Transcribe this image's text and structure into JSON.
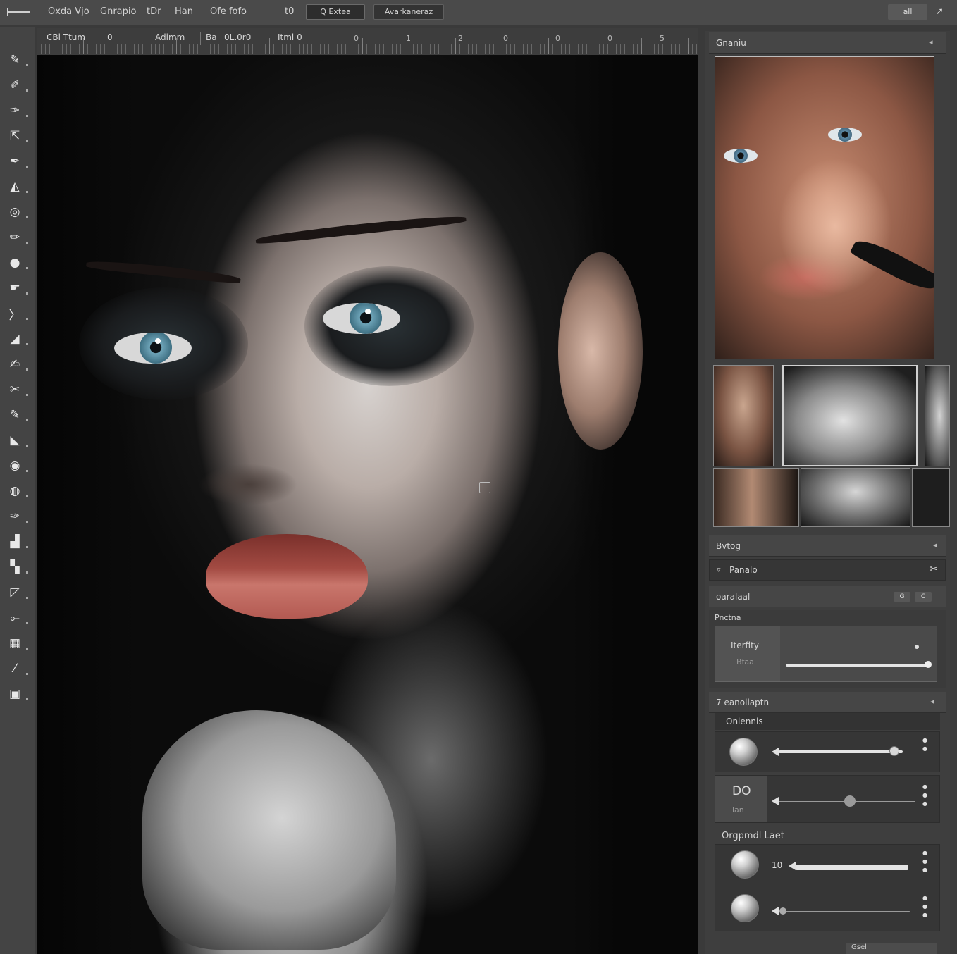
{
  "menubar": {
    "items": [
      "Oxda Vjo",
      "Gnrapio",
      "tDr",
      "Han",
      "Ofe fofo",
      "t0"
    ],
    "buttons": [
      "Q Extea",
      "Avarkaneraz"
    ],
    "window_control": "all"
  },
  "options": {
    "items": [
      "CBl Ttum",
      "0",
      "Adimm",
      "Ba",
      "0L.0r0",
      "Itml 0"
    ],
    "ruler_numbers": [
      "0",
      "1",
      "2",
      "0",
      "0",
      "0",
      "5"
    ]
  },
  "toolbar": {
    "tools": [
      {
        "name": "brush-tool",
        "glyph": "✎"
      },
      {
        "name": "spot-heal-tool",
        "glyph": "✐"
      },
      {
        "name": "clone-stamp-tool",
        "glyph": "✑"
      },
      {
        "name": "move-tool",
        "glyph": "⇱"
      },
      {
        "name": "pen-tool",
        "glyph": "✒"
      },
      {
        "name": "paint-bucket-tool",
        "glyph": "◭"
      },
      {
        "name": "dodge-tool",
        "glyph": "◎"
      },
      {
        "name": "pencil-tool",
        "glyph": "✏"
      },
      {
        "name": "blur-tool",
        "glyph": "●"
      },
      {
        "name": "smudge-tool",
        "glyph": "☛"
      },
      {
        "name": "path-tool",
        "glyph": "〉"
      },
      {
        "name": "gradient-tool",
        "glyph": "◢"
      },
      {
        "name": "burn-tool",
        "glyph": "✍"
      },
      {
        "name": "lasso-tool",
        "glyph": "✂"
      },
      {
        "name": "eraser-tool",
        "glyph": "✎"
      },
      {
        "name": "fill-tool",
        "glyph": "◣"
      },
      {
        "name": "sponge-tool",
        "glyph": "◉"
      },
      {
        "name": "history-brush-tool",
        "glyph": "◍"
      },
      {
        "name": "eyedropper-tool",
        "glyph": "✑"
      },
      {
        "name": "shape-tool",
        "glyph": "▟"
      },
      {
        "name": "stamp-tool",
        "glyph": "▚"
      },
      {
        "name": "line-tool",
        "glyph": "◸"
      },
      {
        "name": "transform-tool",
        "glyph": "⟜"
      },
      {
        "name": "artboard-tool",
        "glyph": "▦"
      },
      {
        "name": "measure-tool",
        "glyph": "⁄"
      },
      {
        "name": "note-tool",
        "glyph": "▣"
      }
    ]
  },
  "panel": {
    "navigator_title": "Gnaniu",
    "layers_title": "Bvtog",
    "layer_row": "Panalo",
    "adjust_title": "oaralaal",
    "adjust_buttons": [
      "G",
      "C"
    ],
    "props_title": "Pnctna",
    "density_label": "Iterfity",
    "density_sub": "Bfaa",
    "curves_title": "7 eanoliaptn",
    "curves_sub": "Onlennis",
    "curves_value": "DO",
    "curves_value_sub": "lan",
    "crop_title": "Orgpmdl Laet",
    "crop_value": "10",
    "footer_btn": "Gsel"
  },
  "sliders": {
    "density_top": 0.95,
    "density_bottom": 0.98,
    "curves_a": 0.93,
    "curves_b": 0.52,
    "crop_a": 1.0,
    "crop_b": 0.02
  },
  "colors": {
    "ui_bg": "#3a3a3a",
    "panel_bg": "#3e3e3e",
    "canvas_bg": "#0a0a0a",
    "iris": "#6ea4b8",
    "lips": "#a24a42"
  }
}
